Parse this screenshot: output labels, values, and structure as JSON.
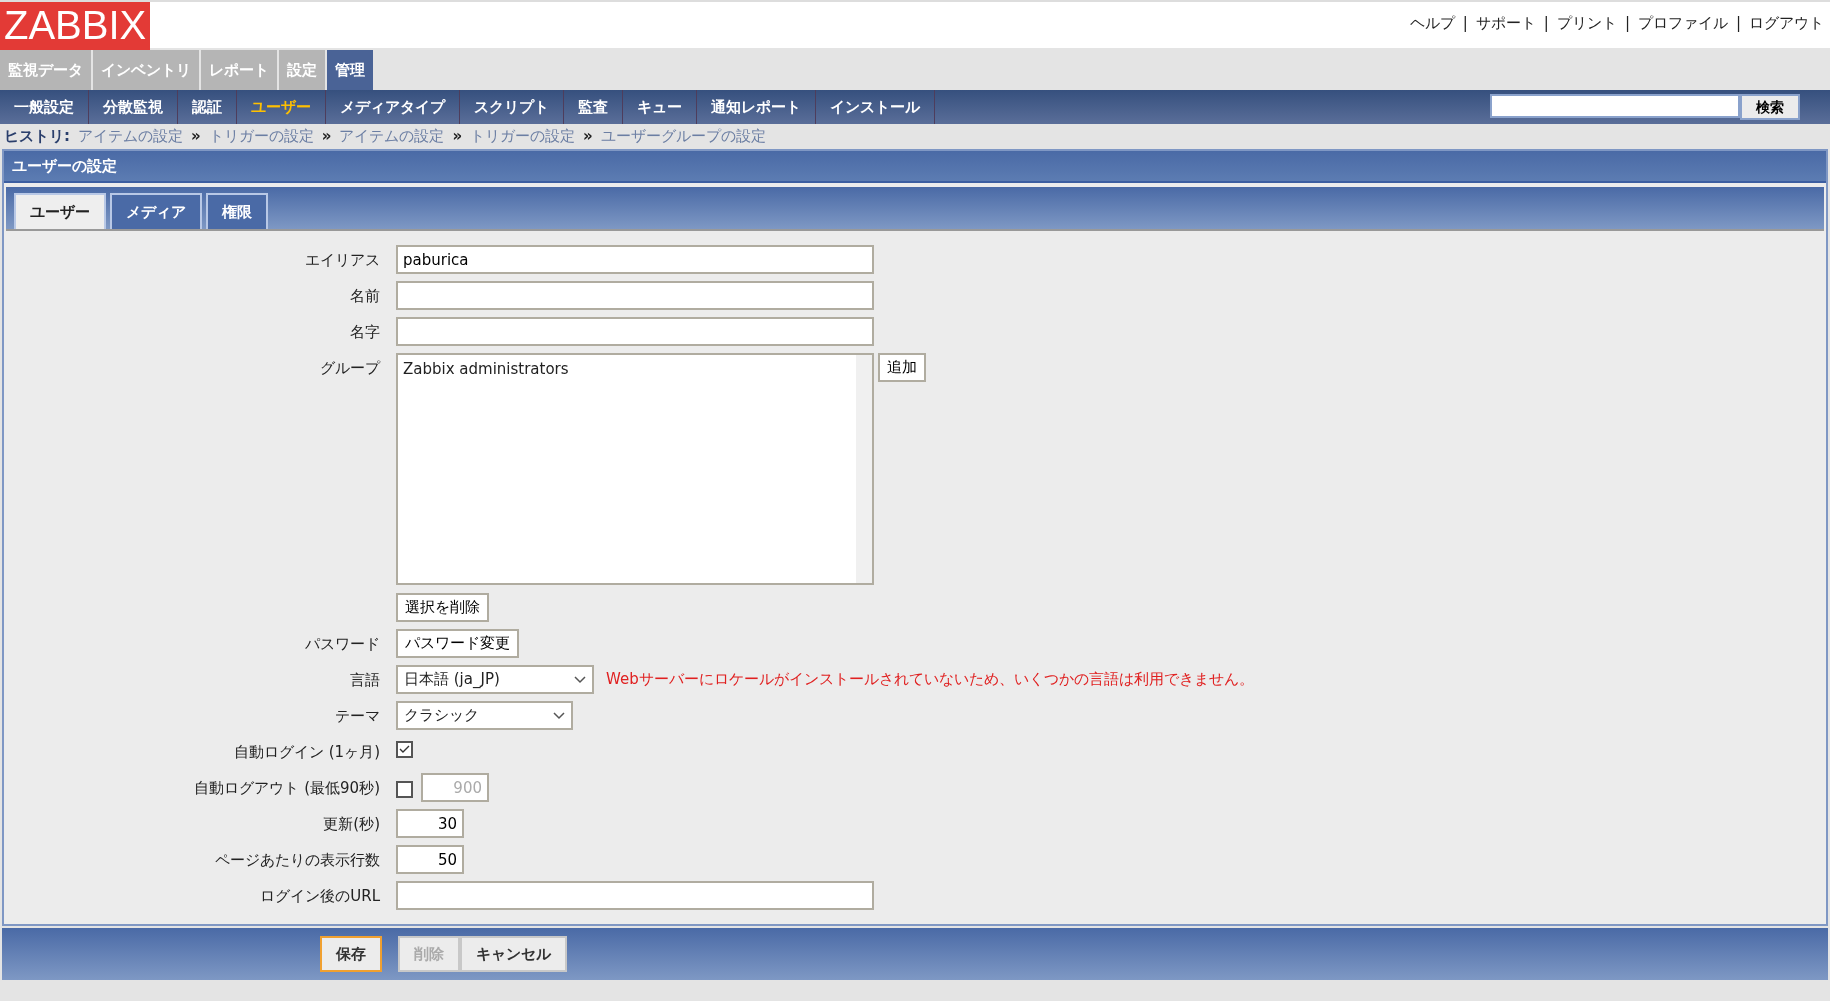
{
  "header": {
    "logo": "ZABBIX",
    "links": [
      {
        "kind": "link",
        "text": "ヘルプ"
      },
      {
        "kind": "sep",
        "text": "|"
      },
      {
        "kind": "link",
        "text": "サポート"
      },
      {
        "kind": "sep",
        "text": "|"
      },
      {
        "kind": "link",
        "text": "プリント"
      },
      {
        "kind": "sep",
        "text": "|"
      },
      {
        "kind": "link",
        "text": "プロファイル"
      },
      {
        "kind": "sep",
        "text": "|"
      },
      {
        "kind": "link",
        "text": "ログアウト"
      }
    ]
  },
  "main_menu": [
    {
      "label": "監視データ",
      "selected": false
    },
    {
      "label": "インベントリ",
      "selected": false
    },
    {
      "label": "レポート",
      "selected": false
    },
    {
      "label": "設定",
      "selected": false
    },
    {
      "label": "管理",
      "selected": true
    }
  ],
  "sub_menu": [
    {
      "label": "一般設定",
      "selected": false
    },
    {
      "label": "分散監視",
      "selected": false
    },
    {
      "label": "認証",
      "selected": false
    },
    {
      "label": "ユーザー",
      "selected": true
    },
    {
      "label": "メディアタイプ",
      "selected": false
    },
    {
      "label": "スクリプト",
      "selected": false
    },
    {
      "label": "監査",
      "selected": false
    },
    {
      "label": "キュー",
      "selected": false
    },
    {
      "label": "通知レポート",
      "selected": false
    },
    {
      "label": "インストール",
      "selected": false
    }
  ],
  "search": {
    "button": "検索"
  },
  "history": {
    "label": "ヒストリ:",
    "trail": [
      {
        "kind": "link",
        "text": "アイテムの設定"
      },
      {
        "kind": "sep",
        "text": "»"
      },
      {
        "kind": "link",
        "text": "トリガーの設定"
      },
      {
        "kind": "sep",
        "text": "»"
      },
      {
        "kind": "link",
        "text": "アイテムの設定"
      },
      {
        "kind": "sep",
        "text": "»"
      },
      {
        "kind": "link",
        "text": "トリガーの設定"
      },
      {
        "kind": "sep",
        "text": "»"
      },
      {
        "kind": "link",
        "text": "ユーザーグループの設定"
      }
    ]
  },
  "title": "ユーザーの設定",
  "tabs": [
    {
      "label": "ユーザー",
      "selected": true
    },
    {
      "label": "メディア",
      "selected": false
    },
    {
      "label": "権限",
      "selected": false
    }
  ],
  "form": {
    "rows": [
      {
        "kind": "text",
        "label": "エイリアス",
        "value": "paburica"
      },
      {
        "kind": "text",
        "label": "名前"
      },
      {
        "kind": "text",
        "label": "名字"
      },
      {
        "kind": "listbox",
        "label": "グループ",
        "options": [
          "Zabbix administrators"
        ],
        "add_button": "追加",
        "remove_button": "選択を削除"
      },
      {
        "kind": "button",
        "label": "パスワード",
        "button": "パスワード変更"
      },
      {
        "kind": "select",
        "label": "言語",
        "value": "日本語 (ja_JP)",
        "warning": "Webサーバーにロケールがインストールされていないため、いくつかの言語は利用できません。"
      },
      {
        "kind": "select",
        "label": "テーマ",
        "value": "クラシック"
      },
      {
        "kind": "checkbox",
        "label": "自動ログイン (1ヶ月)",
        "checked": true
      },
      {
        "kind": "checkbox_number",
        "label": "自動ログアウト (最低90秒)",
        "checked": false,
        "value": "900"
      },
      {
        "kind": "number",
        "label": "更新(秒)",
        "value": "30"
      },
      {
        "kind": "number",
        "label": "ページあたりの表示行数",
        "value": "50"
      },
      {
        "kind": "text",
        "label": "ログイン後のURL"
      }
    ]
  },
  "footer": {
    "buttons": [
      {
        "label": "保存",
        "focused": true,
        "disabled": false
      },
      {
        "label": "削除",
        "focused": false,
        "disabled": true
      },
      {
        "label": "キャンセル",
        "focused": false,
        "disabled": false
      }
    ]
  }
}
